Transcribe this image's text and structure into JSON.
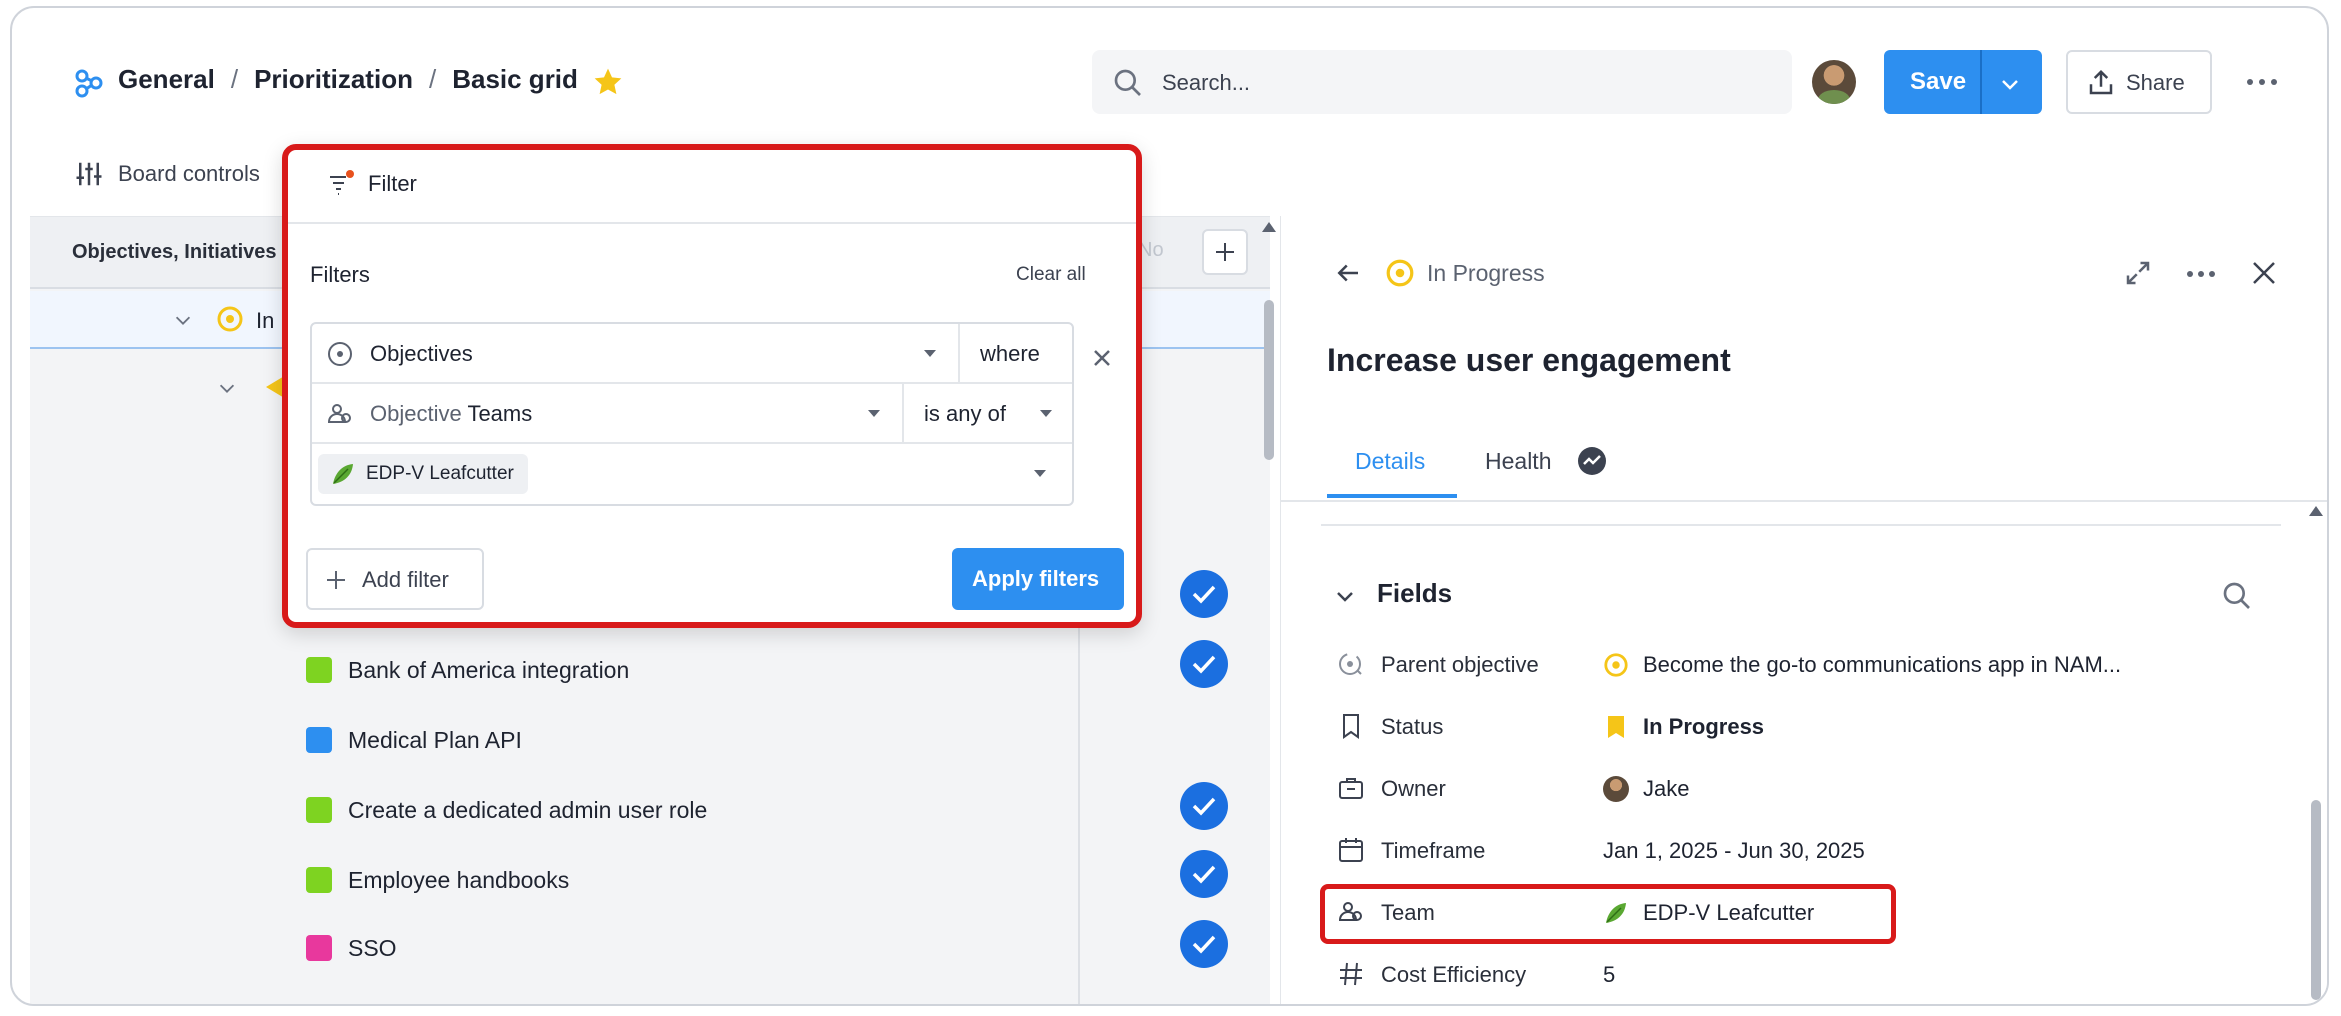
{
  "breadcrumb": {
    "items": [
      "General",
      "Prioritization",
      "Basic grid"
    ],
    "separator": "/"
  },
  "search": {
    "placeholder": "Search..."
  },
  "toolbar": {
    "save_label": "Save",
    "share_label": "Share"
  },
  "board_controls": {
    "label": "Board controls"
  },
  "grid": {
    "column_header": "Objectives, Initiatives",
    "column_header_faded": "No",
    "row1_text": "In",
    "items": [
      {
        "label": "Bank of America integration",
        "color": "#7ed321",
        "checked": true
      },
      {
        "label": "Medical Plan API",
        "color": "#2d8ff0",
        "checked": false
      },
      {
        "label": "Create a dedicated admin user role",
        "color": "#7ed321",
        "checked": true
      },
      {
        "label": "Employee handbooks",
        "color": "#7ed321",
        "checked": true
      },
      {
        "label": "SSO",
        "color": "#e8389d",
        "checked": true
      }
    ]
  },
  "filter_popover": {
    "tab_label": "Filter",
    "heading": "Filters",
    "clear_all": "Clear all",
    "row1": {
      "field": "Objectives",
      "operator": "where"
    },
    "row2": {
      "field_prefix": "Objective",
      "field": "Teams",
      "operator": "is any of"
    },
    "row3": {
      "chip": "EDP-V Leafcutter"
    },
    "add_filter": "Add filter",
    "apply_filters": "Apply filters"
  },
  "detail": {
    "status": "In Progress",
    "title": "Increase user engagement",
    "tabs": [
      {
        "label": "Details",
        "active": true
      },
      {
        "label": "Health",
        "active": false
      }
    ],
    "fields_heading": "Fields",
    "fields": {
      "parent_objective": {
        "label": "Parent objective",
        "value": "Become the go-to communications app in NAM..."
      },
      "status": {
        "label": "Status",
        "value": "In Progress"
      },
      "owner": {
        "label": "Owner",
        "value": "Jake"
      },
      "timeframe": {
        "label": "Timeframe",
        "value": "Jan 1, 2025 - Jun 30, 2025"
      },
      "team": {
        "label": "Team",
        "value": "EDP-V Leafcutter"
      },
      "cost_efficiency": {
        "label": "Cost Efficiency",
        "value": "5"
      }
    }
  },
  "colors": {
    "accent": "#2d8ff0",
    "highlight": "#d81a1a",
    "status_yellow": "#f5c518"
  }
}
